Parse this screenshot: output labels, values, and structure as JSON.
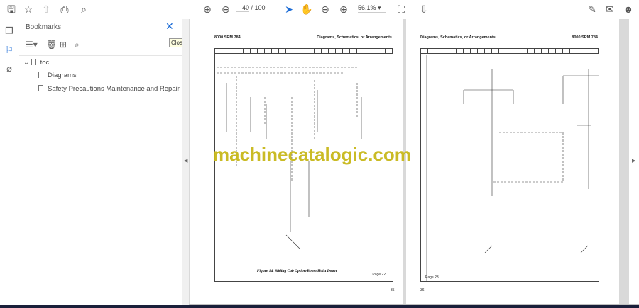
{
  "toolbar": {
    "page_current": "40",
    "page_total": "/ 100",
    "zoom": "56,1%",
    "icons": [
      "save-icon",
      "star-icon",
      "upload-icon",
      "print-icon",
      "search-zoom-icon",
      "page-up-icon",
      "page-down-icon",
      "select-cursor-icon",
      "hand-icon",
      "zoom-out-icon",
      "zoom-in-icon",
      "page-fit-icon",
      "scroll-mode-icon",
      "sign-icon",
      "mail-icon",
      "account-icon"
    ]
  },
  "bookmarks": {
    "title": "Bookmarks",
    "close_tooltip": "Close",
    "items": [
      {
        "label": "toc"
      },
      {
        "label": "Diagrams"
      },
      {
        "label": "Safety Precautions Maintenance and Repair"
      }
    ]
  },
  "document": {
    "left": {
      "header_left": "8000 SRM 784",
      "header_right": "Diagrams, Schematics, or Arrangements",
      "page_label": "Page 22",
      "caption": "Figure 14. Sliding Cab Option/Boom Hoist Down",
      "page_number": "35"
    },
    "right": {
      "header_left": "Diagrams, Schematics, or Arrangements",
      "header_right": "8000 SRM 784",
      "page_label": "Page 23",
      "page_number": "36"
    },
    "watermark": "machinecatalogic.com"
  },
  "colors": {
    "accent": "#1a6bd6",
    "watermark": "#c8b81a"
  }
}
